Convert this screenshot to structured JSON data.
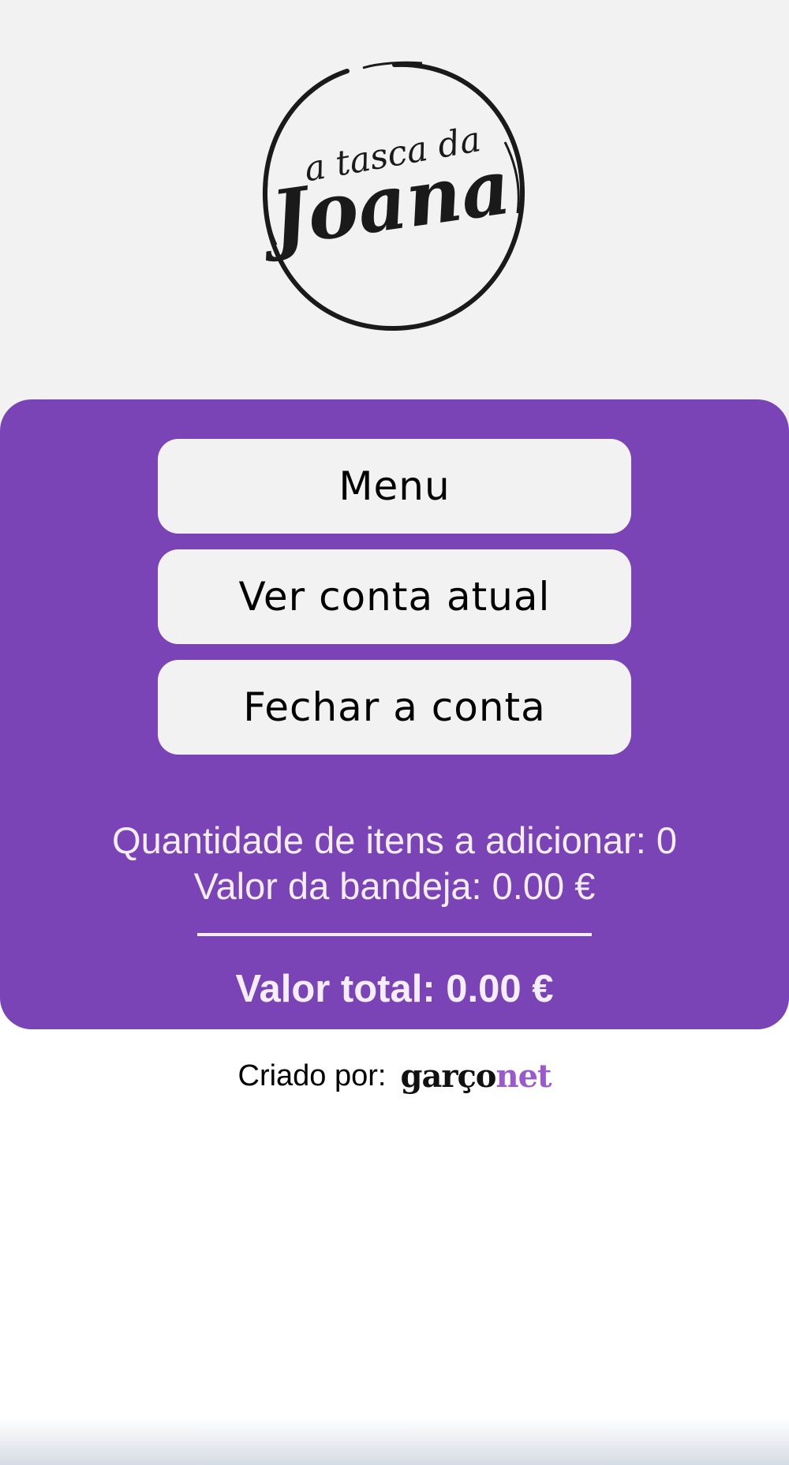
{
  "logo": {
    "line1": "a tasca da",
    "line2": "Joana"
  },
  "actions": {
    "menu_label": "Menu",
    "view_bill_label": "Ver conta atual",
    "close_bill_label": "Fechar a conta"
  },
  "summary": {
    "items_to_add": "Quantidade de itens a adicionar: 0",
    "tray_value": "Valor da bandeja: 0.00 €",
    "total_value": "Valor total: 0.00 €"
  },
  "footer": {
    "created_by_label": "Criado por:",
    "brand_part1": "garço",
    "brand_part2": "net"
  },
  "colors": {
    "panel": "#7a43b6",
    "header_bg": "#f2f2f2",
    "brand_accent": "#9b59d0"
  }
}
